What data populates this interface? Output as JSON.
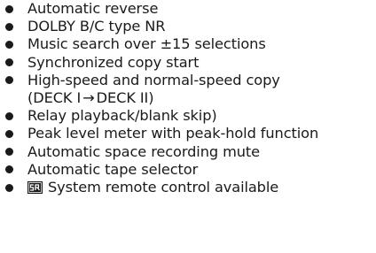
{
  "features": [
    {
      "text": "Automatic reverse"
    },
    {
      "text": "DOLBY B/C type NR"
    },
    {
      "text": "Music search over ±15 selections"
    },
    {
      "text": "Synchronized copy start"
    },
    {
      "text": "High-speed and normal-speed copy",
      "line2_a": "(DECK I",
      "arrow": "→",
      "line2_b": "DECK II)"
    },
    {
      "text": "Relay playback/blank skip)"
    },
    {
      "text": "Peak level meter with peak-hold function"
    },
    {
      "text": "Automatic space recording mute"
    },
    {
      "text": "Automatic tape selector"
    },
    {
      "icon": "sr-system-remote-icon",
      "text": "System remote control available"
    }
  ]
}
